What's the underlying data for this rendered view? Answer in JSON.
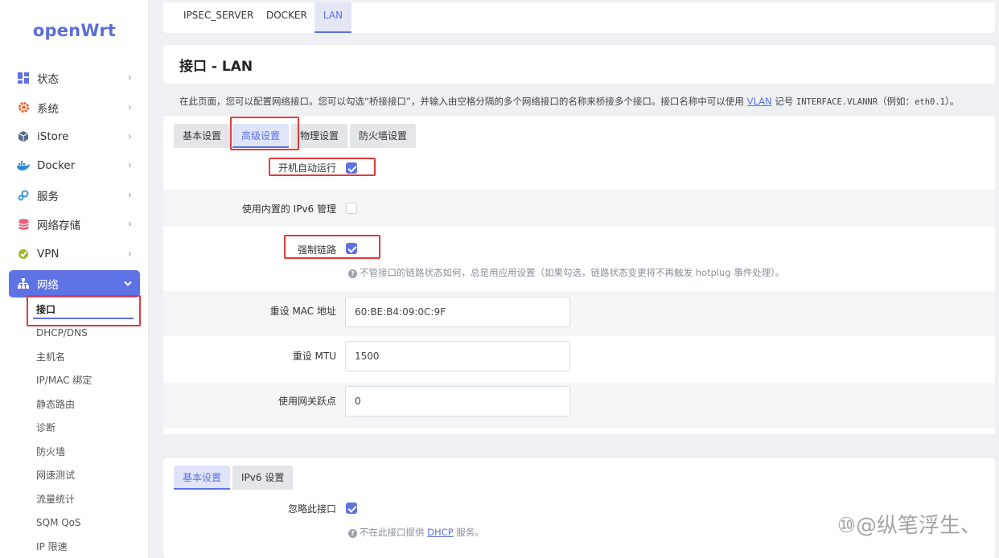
{
  "sidebar": {
    "logo": "openWrt",
    "items": [
      {
        "label": "状态",
        "icon": "dashboard-icon"
      },
      {
        "label": "系统",
        "icon": "gear-icon"
      },
      {
        "label": "iStore",
        "icon": "cube-icon"
      },
      {
        "label": "Docker",
        "icon": "docker-icon"
      },
      {
        "label": "服务",
        "icon": "services-icon"
      },
      {
        "label": "网络存储",
        "icon": "database-icon"
      },
      {
        "label": "VPN",
        "icon": "vpn-icon"
      },
      {
        "label": "网络",
        "icon": "network-icon"
      }
    ],
    "submenu": [
      "接口",
      "DHCP/DNS",
      "主机名",
      "IP/MAC 绑定",
      "静态路由",
      "诊断",
      "防火墙",
      "网速测试",
      "流量统计",
      "SQM QoS",
      "IP 限速"
    ]
  },
  "top_tabs": [
    "IPSEC_SERVER",
    "DOCKER",
    "LAN"
  ],
  "page": {
    "title": "接口 - LAN",
    "desc_before": "在此页面，您可以配置网络接口。您可以勾选“桥接接口”，并输入由空格分隔的多个网络接口的名称来桥接多个接口。接口名称中可以使用",
    "desc_link": "VLAN",
    "desc_mid": "记号",
    "desc_code": "INTERFACE.VLANNR",
    "desc_after": "（例如：",
    "desc_example": "eth0.1",
    "desc_end": "）。"
  },
  "settings_tabs": [
    "基本设置",
    "高级设置",
    "物理设置",
    "防火墙设置"
  ],
  "fields": {
    "autostart": {
      "label": "开机自动运行",
      "checked": true
    },
    "ipv6": {
      "label": "使用内置的 IPv6 管理",
      "checked": false
    },
    "force_link": {
      "label": "强制链路",
      "checked": true,
      "hint": "不管接口的链路状态如何，总是用应用设置（如果勾选，链路状态变更将不再触发 hotplug 事件处理）。"
    },
    "mac": {
      "label": "重设 MAC 地址",
      "value": "60:BE:B4:09:0C:9F"
    },
    "mtu": {
      "label": "重设 MTU",
      "value": "1500"
    },
    "metric": {
      "label": "使用网关跃点",
      "value": "0"
    }
  },
  "dhcp": {
    "tabs": [
      "基本设置",
      "IPv6 设置"
    ],
    "ignore": {
      "label": "忽略此接口",
      "checked": true
    },
    "hint_before": "不在此接口提供",
    "hint_link": "DHCP",
    "hint_after": "服务。"
  },
  "watermark": "⑩@纵笔浮生、",
  "colors": {
    "accent": "#5e72e4",
    "highlight": "#e03a3a"
  }
}
